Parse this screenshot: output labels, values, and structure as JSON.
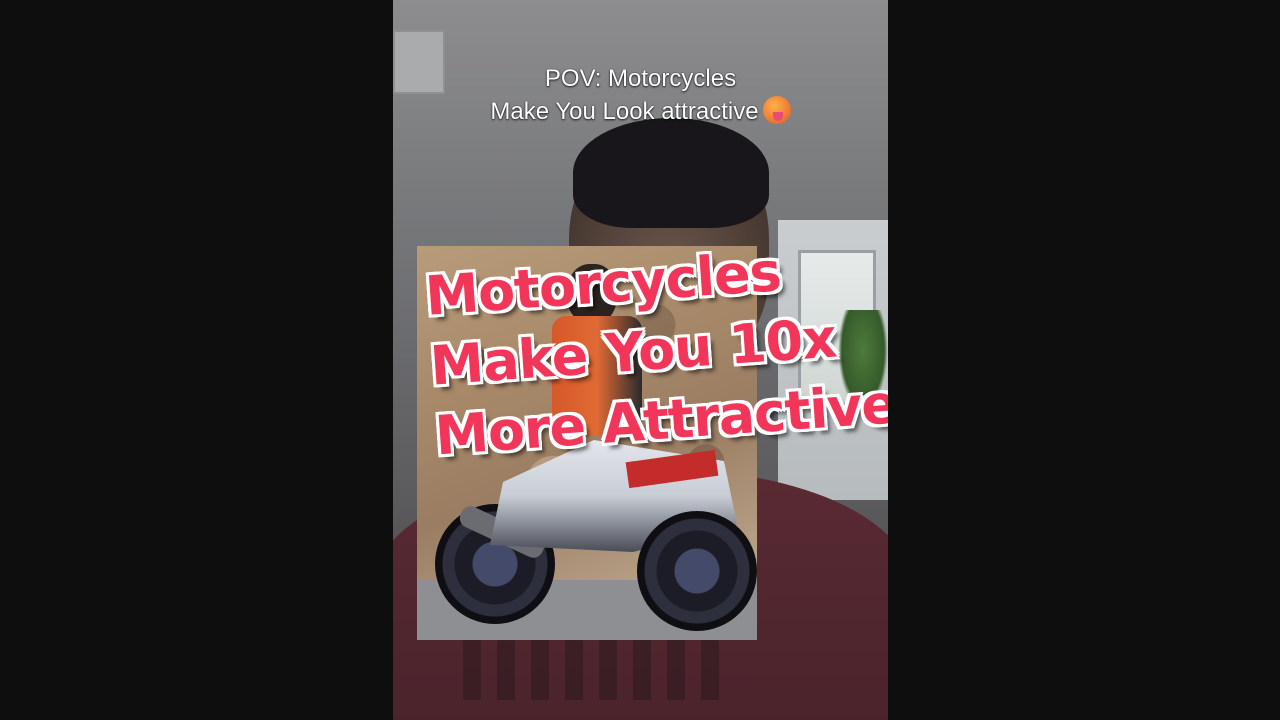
{
  "caption": {
    "line1": "POV: Motorcycles",
    "line2": "Make You Look attractive",
    "emoji_icon": "hot-face-emoji"
  },
  "overlay_text": {
    "line1": "Motorcycles",
    "line2": "Make You 10x",
    "line3": "More Attractive"
  },
  "colors": {
    "overlay_text": "#f2365a",
    "overlay_outline": "#ffffff",
    "letterbox": "#0e0e0e"
  }
}
